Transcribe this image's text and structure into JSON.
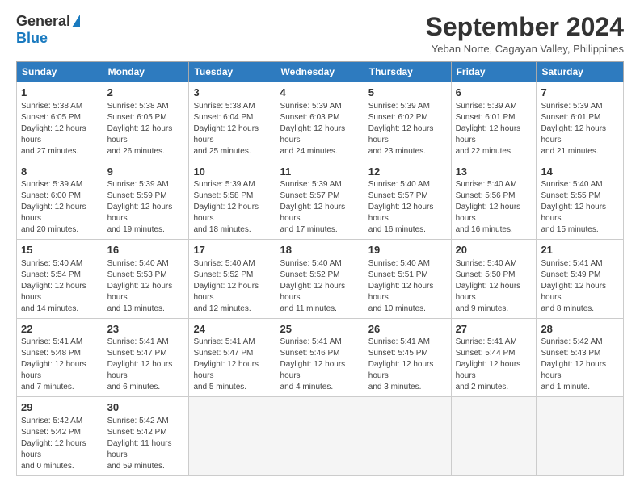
{
  "logo": {
    "general": "General",
    "blue": "Blue"
  },
  "title": "September 2024",
  "subtitle": "Yeban Norte, Cagayan Valley, Philippines",
  "weekdays": [
    "Sunday",
    "Monday",
    "Tuesday",
    "Wednesday",
    "Thursday",
    "Friday",
    "Saturday"
  ],
  "weeks": [
    [
      {
        "day": "1",
        "sunrise": "5:38 AM",
        "sunset": "6:05 PM",
        "daylight": "12 hours and 27 minutes."
      },
      {
        "day": "2",
        "sunrise": "5:38 AM",
        "sunset": "6:05 PM",
        "daylight": "12 hours and 26 minutes."
      },
      {
        "day": "3",
        "sunrise": "5:38 AM",
        "sunset": "6:04 PM",
        "daylight": "12 hours and 25 minutes."
      },
      {
        "day": "4",
        "sunrise": "5:39 AM",
        "sunset": "6:03 PM",
        "daylight": "12 hours and 24 minutes."
      },
      {
        "day": "5",
        "sunrise": "5:39 AM",
        "sunset": "6:02 PM",
        "daylight": "12 hours and 23 minutes."
      },
      {
        "day": "6",
        "sunrise": "5:39 AM",
        "sunset": "6:01 PM",
        "daylight": "12 hours and 22 minutes."
      },
      {
        "day": "7",
        "sunrise": "5:39 AM",
        "sunset": "6:01 PM",
        "daylight": "12 hours and 21 minutes."
      }
    ],
    [
      {
        "day": "8",
        "sunrise": "5:39 AM",
        "sunset": "6:00 PM",
        "daylight": "12 hours and 20 minutes."
      },
      {
        "day": "9",
        "sunrise": "5:39 AM",
        "sunset": "5:59 PM",
        "daylight": "12 hours and 19 minutes."
      },
      {
        "day": "10",
        "sunrise": "5:39 AM",
        "sunset": "5:58 PM",
        "daylight": "12 hours and 18 minutes."
      },
      {
        "day": "11",
        "sunrise": "5:39 AM",
        "sunset": "5:57 PM",
        "daylight": "12 hours and 17 minutes."
      },
      {
        "day": "12",
        "sunrise": "5:40 AM",
        "sunset": "5:57 PM",
        "daylight": "12 hours and 16 minutes."
      },
      {
        "day": "13",
        "sunrise": "5:40 AM",
        "sunset": "5:56 PM",
        "daylight": "12 hours and 16 minutes."
      },
      {
        "day": "14",
        "sunrise": "5:40 AM",
        "sunset": "5:55 PM",
        "daylight": "12 hours and 15 minutes."
      }
    ],
    [
      {
        "day": "15",
        "sunrise": "5:40 AM",
        "sunset": "5:54 PM",
        "daylight": "12 hours and 14 minutes."
      },
      {
        "day": "16",
        "sunrise": "5:40 AM",
        "sunset": "5:53 PM",
        "daylight": "12 hours and 13 minutes."
      },
      {
        "day": "17",
        "sunrise": "5:40 AM",
        "sunset": "5:52 PM",
        "daylight": "12 hours and 12 minutes."
      },
      {
        "day": "18",
        "sunrise": "5:40 AM",
        "sunset": "5:52 PM",
        "daylight": "12 hours and 11 minutes."
      },
      {
        "day": "19",
        "sunrise": "5:40 AM",
        "sunset": "5:51 PM",
        "daylight": "12 hours and 10 minutes."
      },
      {
        "day": "20",
        "sunrise": "5:40 AM",
        "sunset": "5:50 PM",
        "daylight": "12 hours and 9 minutes."
      },
      {
        "day": "21",
        "sunrise": "5:41 AM",
        "sunset": "5:49 PM",
        "daylight": "12 hours and 8 minutes."
      }
    ],
    [
      {
        "day": "22",
        "sunrise": "5:41 AM",
        "sunset": "5:48 PM",
        "daylight": "12 hours and 7 minutes."
      },
      {
        "day": "23",
        "sunrise": "5:41 AM",
        "sunset": "5:47 PM",
        "daylight": "12 hours and 6 minutes."
      },
      {
        "day": "24",
        "sunrise": "5:41 AM",
        "sunset": "5:47 PM",
        "daylight": "12 hours and 5 minutes."
      },
      {
        "day": "25",
        "sunrise": "5:41 AM",
        "sunset": "5:46 PM",
        "daylight": "12 hours and 4 minutes."
      },
      {
        "day": "26",
        "sunrise": "5:41 AM",
        "sunset": "5:45 PM",
        "daylight": "12 hours and 3 minutes."
      },
      {
        "day": "27",
        "sunrise": "5:41 AM",
        "sunset": "5:44 PM",
        "daylight": "12 hours and 2 minutes."
      },
      {
        "day": "28",
        "sunrise": "5:42 AM",
        "sunset": "5:43 PM",
        "daylight": "12 hours and 1 minute."
      }
    ],
    [
      {
        "day": "29",
        "sunrise": "5:42 AM",
        "sunset": "5:42 PM",
        "daylight": "12 hours and 0 minutes."
      },
      {
        "day": "30",
        "sunrise": "5:42 AM",
        "sunset": "5:42 PM",
        "daylight": "11 hours and 59 minutes."
      },
      null,
      null,
      null,
      null,
      null
    ]
  ],
  "labels": {
    "sunrise": "Sunrise:",
    "sunset": "Sunset:",
    "daylight": "Daylight hours"
  }
}
